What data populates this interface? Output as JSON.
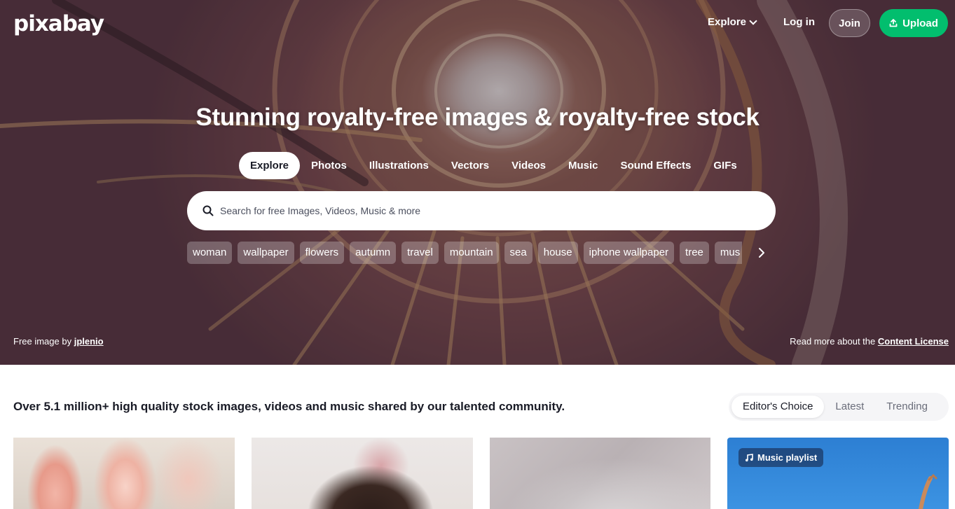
{
  "header": {
    "logo": "pixabay",
    "explore_label": "Explore",
    "login_label": "Log in",
    "join_label": "Join",
    "upload_label": "Upload"
  },
  "hero": {
    "headline": "Stunning royalty-free images & royalty-free stock",
    "tabs": [
      {
        "label": "Explore",
        "active": true
      },
      {
        "label": "Photos"
      },
      {
        "label": "Illustrations"
      },
      {
        "label": "Vectors"
      },
      {
        "label": "Videos"
      },
      {
        "label": "Music"
      },
      {
        "label": "Sound Effects"
      },
      {
        "label": "GIFs"
      }
    ],
    "search_placeholder": "Search for free Images, Videos, Music & more",
    "chips": [
      "woman",
      "wallpaper",
      "flowers",
      "autumn",
      "travel",
      "mountain",
      "sea",
      "house",
      "iphone wallpaper",
      "tree",
      "mus"
    ],
    "credit_prefix": "Free image by",
    "credit_author": "jplenio",
    "license_prefix": "Read more about the",
    "license_link": "Content License"
  },
  "main": {
    "tagline": "Over 5.1 million+ high quality stock images, videos and music shared by our talented community.",
    "sort": [
      "Editor's Choice",
      "Latest",
      "Trending"
    ],
    "music_badge": "Music playlist"
  },
  "colors": {
    "accent_green": "#02be6e",
    "text_dark": "#191b26"
  }
}
